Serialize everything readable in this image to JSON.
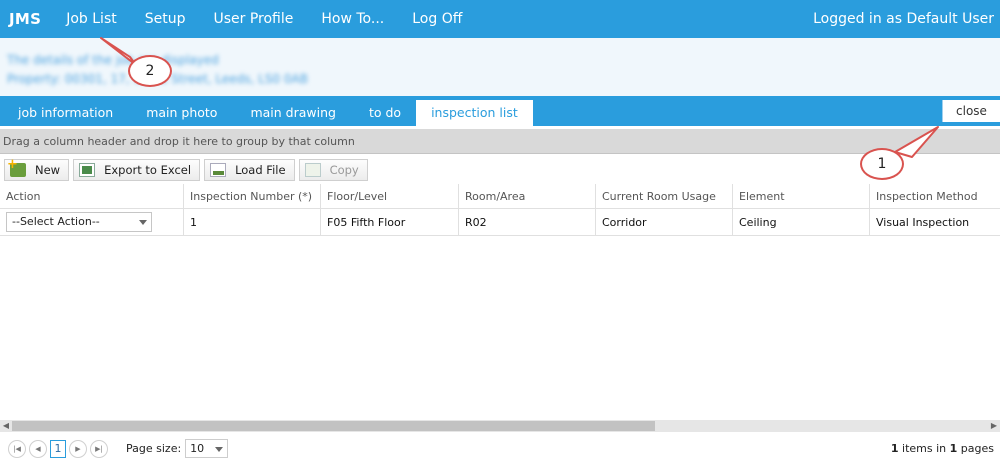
{
  "app": {
    "brand": "JMS",
    "nav": [
      "Job List",
      "Setup",
      "User Profile",
      "How To...",
      "Log Off"
    ],
    "user_status": "Logged in as Default User"
  },
  "job_header": {
    "line1": "The details of the job are displayed",
    "line2": "Property: 00301, 17, Some Street, Leeds, LS0 0AB"
  },
  "tabs": [
    "job information",
    "main photo",
    "main drawing",
    "to do",
    "inspection list"
  ],
  "active_tab": "inspection list",
  "close_label": "close",
  "group_hint": "Drag a column header and drop it here to group by that column",
  "toolbar": {
    "new_label": "New",
    "export_label": "Export to Excel",
    "load_label": "Load File",
    "copy_label": "Copy"
  },
  "grid": {
    "columns": [
      "Action",
      "Inspection Number (*)",
      "Floor/Level",
      "Room/Area",
      "Current Room Usage",
      "Element",
      "Inspection Method"
    ],
    "rows": [
      {
        "action": "--Select Action--",
        "inspection_number": "1",
        "floor": "F05 Fifth Floor",
        "room": "R02",
        "usage": "Corridor",
        "element": "Ceiling",
        "method": "Visual Inspection"
      }
    ]
  },
  "pager": {
    "current_page": "1",
    "page_size_label": "Page size:",
    "page_size": "10",
    "items_count": "1",
    "items_text": " items in ",
    "pages_count": "1",
    "pages_text": " pages"
  },
  "callouts": [
    "1",
    "2"
  ],
  "colors": {
    "accent": "#2a9ddd",
    "callout_border": "#d9534f"
  }
}
